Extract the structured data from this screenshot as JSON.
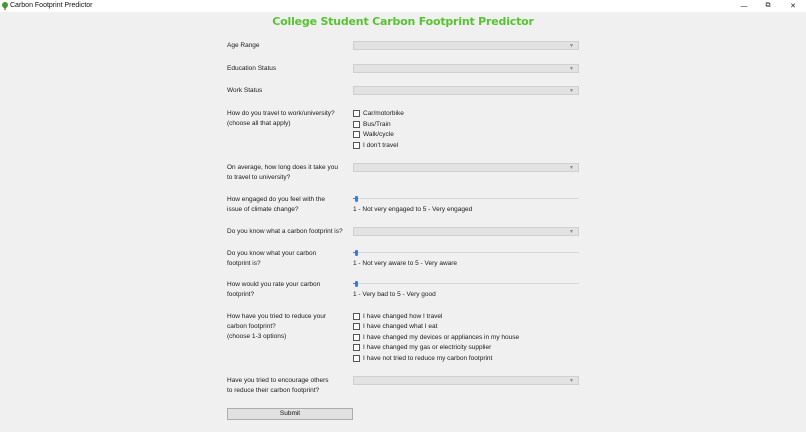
{
  "window": {
    "title": "Carbon Footprint Predictor",
    "minimize_glyph": "—",
    "maximize_glyph": "⧉",
    "close_glyph": "✕"
  },
  "form": {
    "title": "College Student Carbon Footprint Predictor",
    "accent_color": "#58c330",
    "age_range": {
      "label": "Age Range",
      "value": ""
    },
    "education_status": {
      "label": "Education Status",
      "value": ""
    },
    "work_status": {
      "label": "Work Status",
      "value": ""
    },
    "travel_mode": {
      "label_line1": "How do you travel to work/university?",
      "label_line2": "(choose all that apply)",
      "options": [
        {
          "label": "Car/motorbike",
          "checked": false
        },
        {
          "label": "Bus/Train",
          "checked": false
        },
        {
          "label": "Walk/cycle",
          "checked": false
        },
        {
          "label": "I don't travel",
          "checked": false
        }
      ]
    },
    "travel_time": {
      "label_line1": "On average, how long does it take you",
      "label_line2": "to travel to university?",
      "value": ""
    },
    "climate_engagement": {
      "label_line1": "How engaged do you feel with the",
      "label_line2": "issue of climate change?",
      "scale_text": "1 - Not very engaged to 5 - Very engaged",
      "value": 1,
      "min": 1,
      "max": 5
    },
    "know_carbon_footprint": {
      "label": "Do you know what a carbon footprint is?",
      "value": ""
    },
    "footprint_awareness": {
      "label_line1": "Do you know what your carbon",
      "label_line2": "footprint is?",
      "scale_text": "1 - Not very aware to 5 - Very aware",
      "value": 1,
      "min": 1,
      "max": 5
    },
    "footprint_rating": {
      "label_line1": "How would you rate your carbon",
      "label_line2": "footprint?",
      "scale_text": "1 - Very bad to 5 - Very good",
      "value": 1,
      "min": 1,
      "max": 5
    },
    "reduction_efforts": {
      "label_line1": "How have you tried to reduce your",
      "label_line2": "carbon footprint?",
      "label_line3": "(choose 1-3 options)",
      "options": [
        {
          "label": "I have changed how I travel",
          "checked": false
        },
        {
          "label": "I have changed what I eat",
          "checked": false
        },
        {
          "label": "I have changed my devices or appliances in my house",
          "checked": false
        },
        {
          "label": "I have changed my gas or electricity supplier",
          "checked": false
        },
        {
          "label": "I have not tried to reduce my carbon footprint",
          "checked": false
        }
      ]
    },
    "encourage_others": {
      "label_line1": "Have you tried to encourage others",
      "label_line2": "to reduce their carbon footprint?",
      "value": ""
    },
    "submit_label": "Submit"
  },
  "icons": {
    "app": "tree-icon",
    "dropdown": "chevron-down-icon"
  }
}
